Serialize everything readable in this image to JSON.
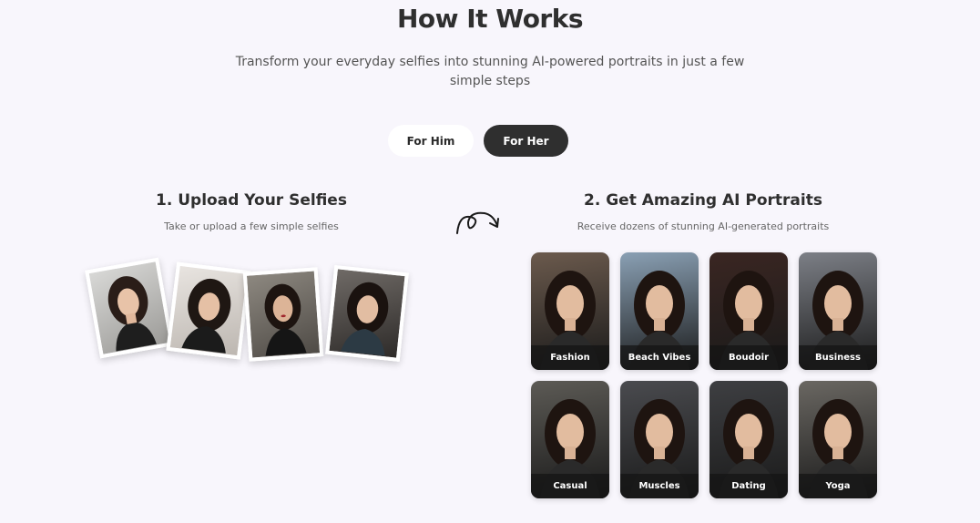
{
  "header": {
    "title": "How It Works",
    "subtitle": "Transform your everyday selfies into stunning AI-powered portraits in just a few simple steps"
  },
  "toggle": {
    "him_label": "For Him",
    "her_label": "For Her",
    "selected": "For Her"
  },
  "step1": {
    "title": "1. Upload Your Selfies",
    "description": "Take or upload a few simple selfies"
  },
  "step2": {
    "title": "2. Get Amazing AI Portraits",
    "description": "Receive dozens of stunning AI-generated portraits"
  },
  "portraits": [
    {
      "label": "Fashion",
      "bg": "#6b5a4d"
    },
    {
      "label": "Beach Vibes",
      "bg": "#8aa0b4"
    },
    {
      "label": "Boudoir",
      "bg": "#3a2622"
    },
    {
      "label": "Business",
      "bg": "#7c7f86"
    },
    {
      "label": "Casual",
      "bg": "#5c5a55"
    },
    {
      "label": "Muscles",
      "bg": "#4a4b4f"
    },
    {
      "label": "Dating",
      "bg": "#3e3f42"
    },
    {
      "label": "Yoga",
      "bg": "#6a6762"
    }
  ],
  "colors": {
    "background": "#f8f6fc",
    "toggle_active": "#2f2f2f",
    "toggle_inactive": "#ffffff"
  }
}
